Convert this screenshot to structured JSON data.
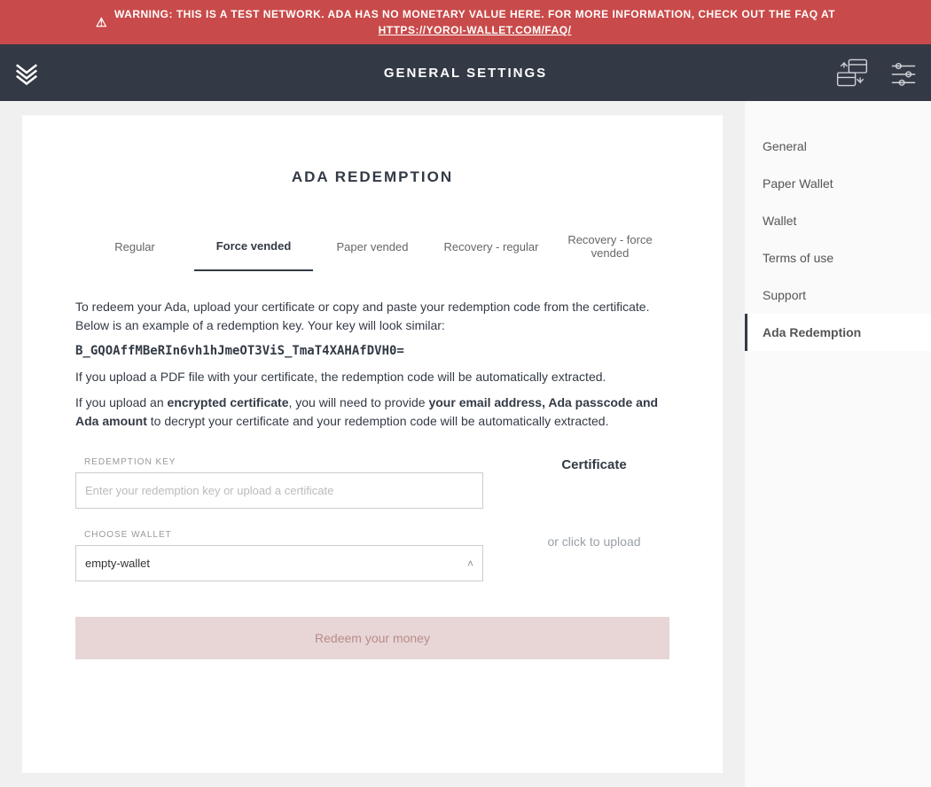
{
  "warning": {
    "prefix": "WARNING: THIS IS A TEST NETWORK. ADA HAS NO MONETARY VALUE HERE. FOR MORE INFORMATION, CHECK OUT THE FAQ AT",
    "link_text": "HTTPS://YOROI-WALLET.COM/FAQ/"
  },
  "header": {
    "title": "GENERAL SETTINGS"
  },
  "sidebar": {
    "items": [
      {
        "label": "General"
      },
      {
        "label": "Paper Wallet"
      },
      {
        "label": "Wallet"
      },
      {
        "label": "Terms of use"
      },
      {
        "label": "Support"
      },
      {
        "label": "Ada Redemption"
      }
    ],
    "active_index": 5
  },
  "form": {
    "title": "ADA REDEMPTION",
    "tabs": [
      {
        "label": "Regular"
      },
      {
        "label": "Force vended"
      },
      {
        "label": "Paper vended"
      },
      {
        "label": "Recovery - regular"
      },
      {
        "label": "Recovery - force vended"
      }
    ],
    "active_tab_index": 1,
    "instructions": {
      "p1_a": "To redeem your Ada, upload your certificate or copy and paste your redemption code from the certificate. Below is an example of a redemption key. Your key will look similar:",
      "example": "B_GQOAffMBeRIn6vh1hJmeOT3ViS_TmaT4XAHAfDVH0=",
      "p2": "If you upload a PDF file with your certificate, the redemption code will be automatically extracted.",
      "p3_a": "If you upload an ",
      "p3_b": "encrypted certificate",
      "p3_c": ", you will need to provide ",
      "p3_d": "your email address, Ada passcode and Ada amount",
      "p3_e": " to decrypt your certificate and your redemption code will be automatically extracted."
    },
    "redemption_key": {
      "label": "REDEMPTION KEY",
      "placeholder": "Enter your redemption key or upload a certificate",
      "value": ""
    },
    "choose_wallet": {
      "label": "CHOOSE WALLET",
      "value": "empty-wallet"
    },
    "certificate": {
      "title": "Certificate",
      "hint": "or click to upload"
    },
    "submit_label": "Redeem your money"
  }
}
